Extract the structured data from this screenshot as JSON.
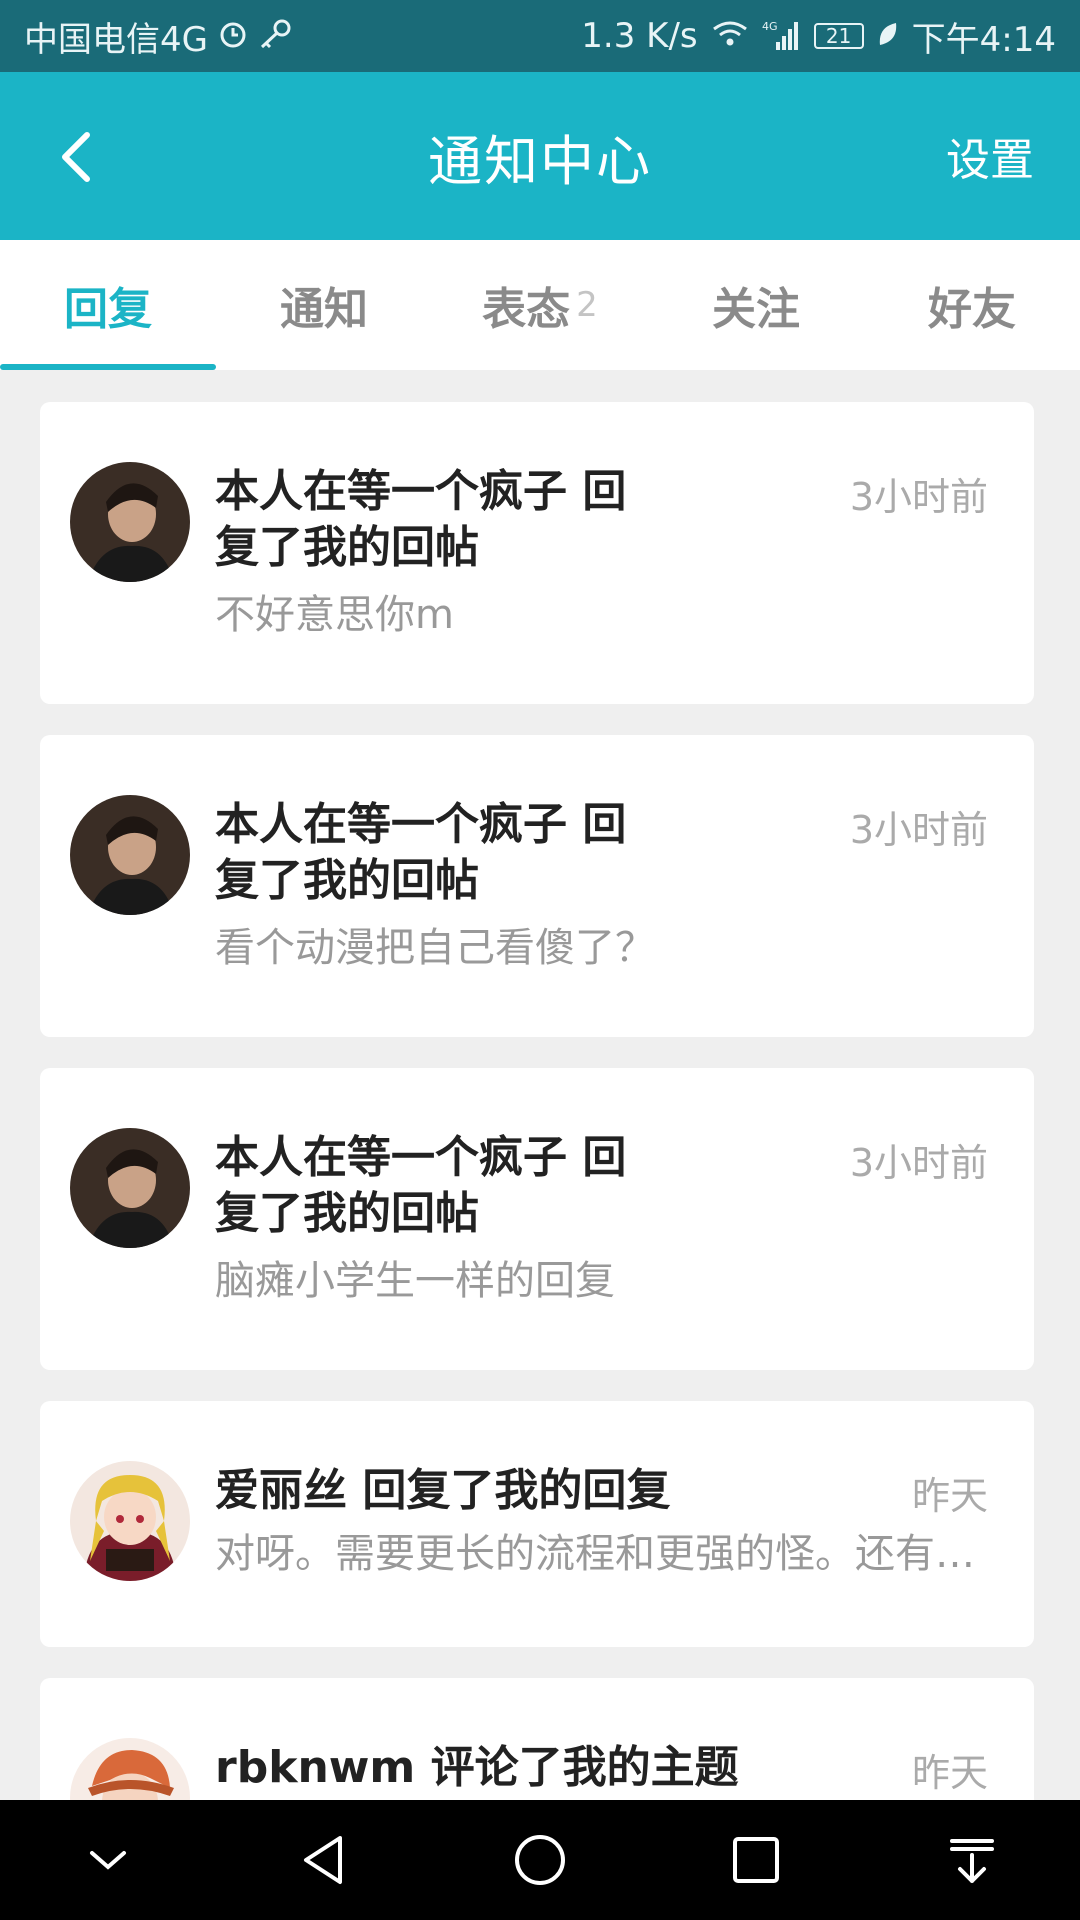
{
  "status_bar": {
    "carrier": "中国电信4G",
    "speed": "1.3 K/s",
    "network": "4G",
    "battery": "21",
    "time": "下午4:14"
  },
  "header": {
    "title": "通知中心",
    "settings_label": "设置",
    "back_icon": "back-arrow-icon"
  },
  "tabs": [
    {
      "label": "回复",
      "active": true
    },
    {
      "label": "通知"
    },
    {
      "label": "表态",
      "badge": "2"
    },
    {
      "label": "关注"
    },
    {
      "label": "好友"
    }
  ],
  "notifications": [
    {
      "title": "本人在等一个疯子 回复了我的回帖",
      "time": "3小时前",
      "body": "不好意思你m",
      "avatar": "user-avatar"
    },
    {
      "title": "本人在等一个疯子 回复了我的回帖",
      "time": "3小时前",
      "body": "看个动漫把自己看傻了？",
      "avatar": "user-avatar"
    },
    {
      "title": "本人在等一个疯子 回复了我的回帖",
      "time": "3小时前",
      "body": "脑瘫小学生一样的回复",
      "avatar": "user-avatar"
    },
    {
      "title": "爱丽丝 回复了我的回复",
      "time": "昨天",
      "body": "对呀。需要更长的流程和更强的怪。还有就是...",
      "avatar": "anime-avatar"
    },
    {
      "title": "rbknwm 评论了我的主题",
      "time": "昨天",
      "body": "",
      "avatar": "anime-avatar-orange"
    }
  ],
  "colors": {
    "accent": "#1bb4c6",
    "status_bar": "#1a6b78",
    "background": "#efefef"
  }
}
